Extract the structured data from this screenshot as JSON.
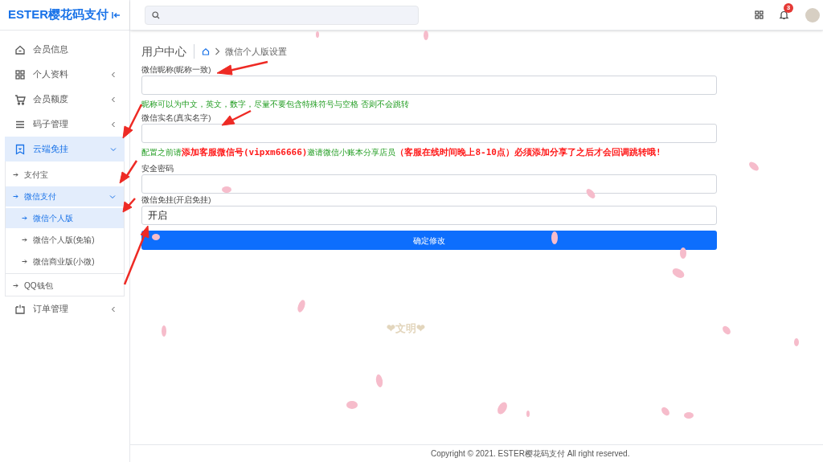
{
  "sidebar": {
    "brand": "ESTER樱花码支付",
    "items": [
      {
        "label": "会员信息",
        "selected": false
      },
      {
        "label": "个人资料",
        "expanded": false,
        "selected": false
      },
      {
        "label": "会员额度",
        "expanded": false,
        "selected": false
      },
      {
        "label": "码子管理",
        "expanded": false,
        "selected": false
      },
      {
        "label": "云端免挂",
        "expanded": true,
        "selected": true,
        "children": [
          {
            "label": "支付宝",
            "selected": false
          },
          {
            "label": "微信支付",
            "expanded": true,
            "selected": true,
            "children": [
              {
                "label": "微信个人版",
                "selected": true
              },
              {
                "label": "微信个人版(免输)",
                "selected": false
              },
              {
                "label": "微信商业版(小微)",
                "selected": false
              }
            ]
          },
          {
            "label": "QQ钱包",
            "selected": false
          }
        ]
      },
      {
        "label": "订单管理",
        "expanded": false,
        "selected": false
      }
    ]
  },
  "header": {
    "notification_count": "3"
  },
  "breadcrumb": {
    "title": "用户中心",
    "current": "微信个人版设置"
  },
  "form": {
    "fields": [
      {
        "label": "微信昵称(昵称一致)",
        "hint": [
          {
            "kind": "note",
            "text": "昵称可以为中文，英文，数字，尽量不要包含特殊符号与空格 否则不会跳转"
          }
        ]
      },
      {
        "label": "微信实名(真实名字)",
        "hint": [
          {
            "kind": "note",
            "text": "配置之前请"
          },
          {
            "kind": "alert",
            "text": "添加客服微信号(vipxm66666)"
          },
          {
            "kind": "note",
            "text": "邀请微信小账本分享店员"
          },
          {
            "kind": "alert",
            "text": "（客服在线时间晚上8-10点）必须添加分享了之后才会回调跳转哦!"
          }
        ]
      },
      {
        "label": "安全密码"
      },
      {
        "label": "微信免挂(开启免挂)",
        "value": "开启"
      }
    ],
    "submit": "确定修改"
  },
  "tagline": "❤文明❤",
  "footer": "Copyright © 2021. ESTER樱花码支付 All right reserved."
}
